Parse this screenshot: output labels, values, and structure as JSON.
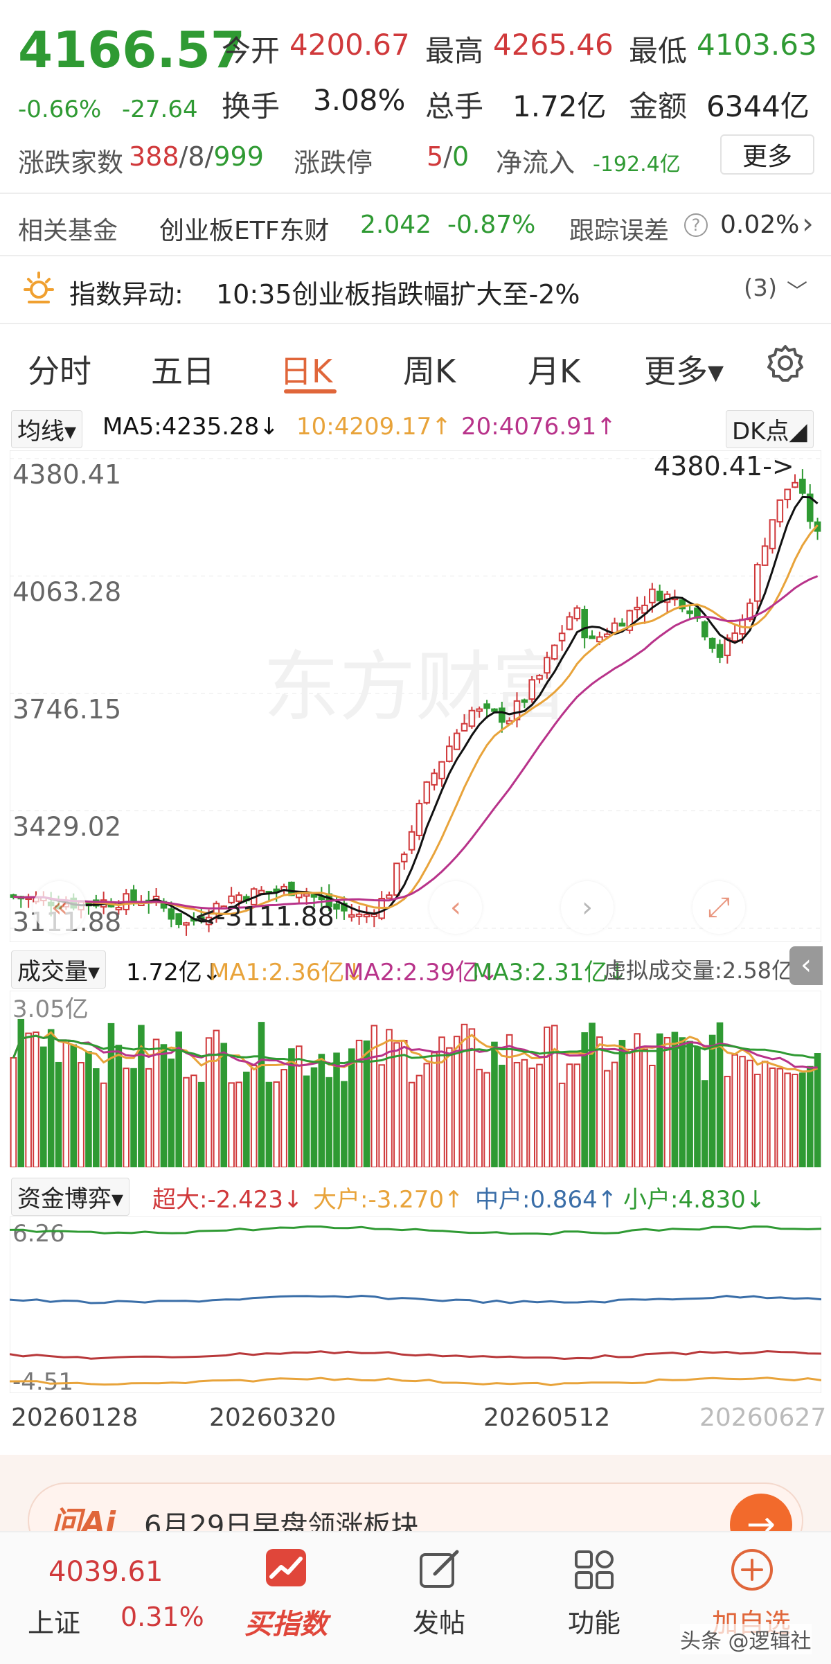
{
  "quote": {
    "price": "4166.57",
    "change_pct": "-0.66%",
    "change_abs": "-27.64",
    "open_label": "今开",
    "open": "4200.67",
    "high_label": "最高",
    "high": "4265.46",
    "low_label": "最低",
    "low": "4103.63",
    "turnover_label": "换手",
    "turnover": "3.08%",
    "volume_label": "总手",
    "volume": "1.72亿",
    "amount_label": "金额",
    "amount": "6344亿",
    "breadth_label": "涨跌家数",
    "breadth_up": "388",
    "breadth_flat": "8",
    "breadth_down": "999",
    "slash": "/",
    "limit_label": "涨跌停",
    "limit_up": "5",
    "limit_down": "0",
    "inflow_label": "净流入",
    "inflow": "-192.4亿",
    "more_btn": "更多"
  },
  "fund": {
    "label": "相关基金",
    "name": "创业板ETF东财",
    "price": "2.042",
    "change": "-0.87%",
    "tracking_label": "跟踪误差",
    "tracking": "0.02%",
    "help_icon": "?",
    "chevron": "›"
  },
  "alert": {
    "prefix": "指数异动:",
    "text": "10:35创业板指跌幅扩大至-2%",
    "count": "(3)",
    "chevron": "﹀"
  },
  "tabs": [
    "分时",
    "五日",
    "日K",
    "周K",
    "月K",
    "更多▾"
  ],
  "ma": {
    "select": "均线▾",
    "ma5": "MA5:4235.28↓",
    "ma10": "10:4209.17↑",
    "ma20": "20:4076.91↑",
    "dk": "DK点◢"
  },
  "kchart": {
    "y_ticks": [
      "4380.41",
      "4063.28",
      "3746.15",
      "3429.02",
      "3111.88"
    ],
    "max_label": "4380.41",
    "min_label": "<-3111.88",
    "watermark": "东方财富"
  },
  "volume": {
    "select": "成交量▾",
    "current": "1.72亿↓",
    "ma1": "MA1:2.36亿↓",
    "ma2": "MA2:2.39亿↓",
    "ma3": "MA3:2.31亿↓",
    "virtual": "虚拟成交量:2.58亿",
    "top_label": "3.05亿"
  },
  "flow": {
    "select": "资金博弈▾",
    "super": "超大:-2.423↓",
    "big": "大户:-3.270↑",
    "mid": "中户:0.864↑",
    "small": "小户:4.830↓",
    "top_label": "6.26",
    "bottom_label": "-4.51"
  },
  "dates": [
    "20260128",
    "20260320",
    "20260512",
    "20260627"
  ],
  "ai": {
    "logo": "问Ai",
    "text": "6月29日早盘领涨板块",
    "arrow": "→"
  },
  "nav": {
    "index_value": "4039.61",
    "index_name": "上证",
    "index_change": "0.31%",
    "buy_label": "买指数",
    "post_label": "发帖",
    "func_label": "功能",
    "fav_label": "加自选"
  },
  "watermark": "头条 @逻辑社",
  "colors": {
    "up": "#d0393b",
    "down": "#2f9a33",
    "accent": "#e0663a",
    "ma5": "#111111",
    "ma10": "#e8a33a",
    "ma20": "#b8338a"
  },
  "chart_data": {
    "type": "candlestick",
    "y_range": [
      3111.88,
      4380.41
    ],
    "max": 4380.41,
    "min": 3111.88
  }
}
